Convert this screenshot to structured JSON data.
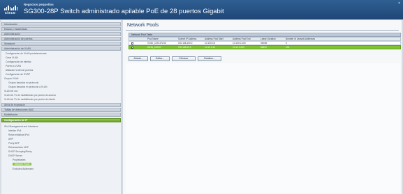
{
  "header": {
    "small_business": "Negocios pequeños",
    "logo_text": "cisco",
    "title": "SG300-28P Switch administrado apilable PoE de 28 puertos Gigabit",
    "close": "×"
  },
  "sidebar": {
    "sections": [
      "Introducción",
      "Estado y estadísticas",
      "Administración",
      "Administración de puertos",
      "Smartport",
      "Administración de VLAN",
      "Árbol de expansión",
      "Tablas de direcciones MAC",
      "Multidifusión",
      "Configuración de IP"
    ],
    "vlan_items": [
      "Configuración de VLAN predeterminada",
      "Crear VLAN",
      "Configuración de interfaz",
      "Puerto a VLAN",
      "Afiliación VLAN de puertos",
      "Configuración de GVRP",
      "Grupos VLAN",
      "Grupos basados en protocolo",
      "Grupos basados en protocolo a VLAN",
      "VLAN de voz",
      "VLAN de TV de multidifusión por puerto de acceso",
      "VLAN de TV de multidifusión por puerto de cliente"
    ],
    "ip_items": [
      "IPv4 Management and Interfaces",
      "Interfaz IPv4",
      "Rutas estáticas IPv4",
      "ARP",
      "Proxy ARP",
      "Retransmisión UDP",
      "DHCP Snooping/Relay",
      "DHCP Server",
      "Propiedades",
      "Network Pools",
      "Excluded Addresses"
    ]
  },
  "main": {
    "page_title": "Network Pools",
    "table_title": "Network Pool Table",
    "columns": [
      "",
      "Pool Name",
      "Subnet IP Address",
      "Address Pool Start",
      "Address Pool End",
      "Lease Duration",
      "Number of Leased Addresses"
    ],
    "rows": [
      [
        "",
        "VOZ0_CISCOVOZ",
        "192.168.100.0",
        "10.100.0.6",
        "10.100.0.100",
        "Infinite",
        "0"
      ],
      [
        "",
        "DATA_CISCO",
        "192.168.10.0",
        "10.10.0.10",
        "10.10.0.200",
        "86400",
        "100"
      ]
    ],
    "buttons": [
      "Añadir...",
      "Editar...",
      "Eliminar",
      "Detalles..."
    ]
  }
}
